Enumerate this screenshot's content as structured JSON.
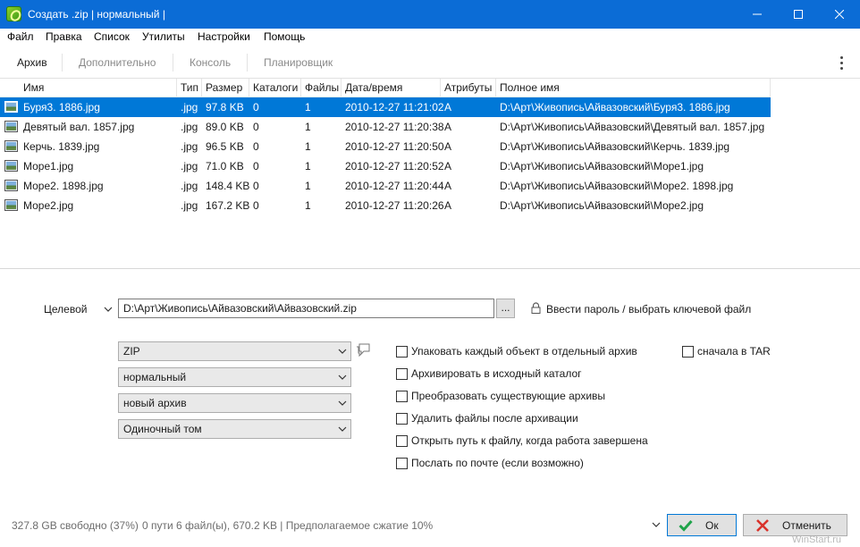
{
  "window": {
    "title": "Создать .zip | нормальный |",
    "controls": [
      "minimize-icon",
      "maximize-icon",
      "close-icon"
    ],
    "accent_color": "#0b6cd6"
  },
  "menu": [
    "Файл",
    "Правка",
    "Список",
    "Утилиты",
    "Настройки",
    "Помощь"
  ],
  "tabs": [
    {
      "label": "Архив",
      "state": "active"
    },
    {
      "label": "Дополнительно",
      "state": "disabled"
    },
    {
      "label": "Консоль",
      "state": "disabled"
    },
    {
      "label": "Планировщик",
      "state": "disabled"
    }
  ],
  "table": {
    "columns": [
      "Имя",
      "Тип",
      "Размер",
      "Каталоги",
      "Файлы",
      "Дата/время",
      "Атрибуты",
      "Полное имя"
    ],
    "selected_color": "#0078d7",
    "rows": [
      {
        "name": "Буря3. 1886.jpg",
        "type": ".jpg",
        "size": "97.8 KB",
        "dirs": "0",
        "files": "1",
        "datetime": "2010-12-27 11:21:02",
        "attr": "A",
        "full": "D:\\Арт\\Живопись\\Айвазовский\\Буря3. 1886.jpg",
        "selected": true
      },
      {
        "name": "Девятый вал. 1857.jpg",
        "type": ".jpg",
        "size": "89.0 KB",
        "dirs": "0",
        "files": "1",
        "datetime": "2010-12-27 11:20:38",
        "attr": "A",
        "full": "D:\\Арт\\Живопись\\Айвазовский\\Девятый вал. 1857.jpg",
        "selected": false
      },
      {
        "name": "Керчь. 1839.jpg",
        "type": ".jpg",
        "size": "96.5 KB",
        "dirs": "0",
        "files": "1",
        "datetime": "2010-12-27 11:20:50",
        "attr": "A",
        "full": "D:\\Арт\\Живопись\\Айвазовский\\Керчь. 1839.jpg",
        "selected": false
      },
      {
        "name": "Море1.jpg",
        "type": ".jpg",
        "size": "71.0 KB",
        "dirs": "0",
        "files": "1",
        "datetime": "2010-12-27 11:20:52",
        "attr": "A",
        "full": "D:\\Арт\\Живопись\\Айвазовский\\Море1.jpg",
        "selected": false
      },
      {
        "name": "Море2. 1898.jpg",
        "type": ".jpg",
        "size": "148.4 KB",
        "dirs": "0",
        "files": "1",
        "datetime": "2010-12-27 11:20:44",
        "attr": "A",
        "full": "D:\\Арт\\Живопись\\Айвазовский\\Море2. 1898.jpg",
        "selected": false
      },
      {
        "name": "Море2.jpg",
        "type": ".jpg",
        "size": "167.2 KB",
        "dirs": "0",
        "files": "1",
        "datetime": "2010-12-27 11:20:26",
        "attr": "A",
        "full": "D:\\Арт\\Живопись\\Айвазовский\\Море2.jpg",
        "selected": false
      }
    ]
  },
  "destination": {
    "label": "Целевой",
    "value": "D:\\Арт\\Живопись\\Айвазовский\\Айвазовский.zip",
    "browse_label": "...",
    "password_label": "Ввести пароль / выбрать ключевой файл"
  },
  "selects": {
    "format": "ZIP",
    "compression": "нормальный",
    "mode": "новый архив",
    "volume": "Одиночный том"
  },
  "options": [
    {
      "label": "Упаковать каждый объект в отдельный архив",
      "checked": false
    },
    {
      "label": "Архивировать в исходный каталог",
      "checked": false
    },
    {
      "label": "Преобразовать существующие архивы",
      "checked": false
    },
    {
      "label": "Удалить файлы после архивации",
      "checked": false
    },
    {
      "label": "Открыть путь к файлу, когда работа завершена",
      "checked": false
    },
    {
      "label": "Послать по почте (если возможно)",
      "checked": false
    }
  ],
  "tar_option": {
    "label": "сначала в TAR",
    "checked": false
  },
  "status": {
    "free_space": "327.8 GB свободно (37%)",
    "summary": "0 пути 6 файл(ы), 670.2 KB | Предполагаемое сжатие 10%"
  },
  "buttons": {
    "ok": "Ок",
    "cancel": "Отменить"
  },
  "watermark": "WinStart.ru"
}
